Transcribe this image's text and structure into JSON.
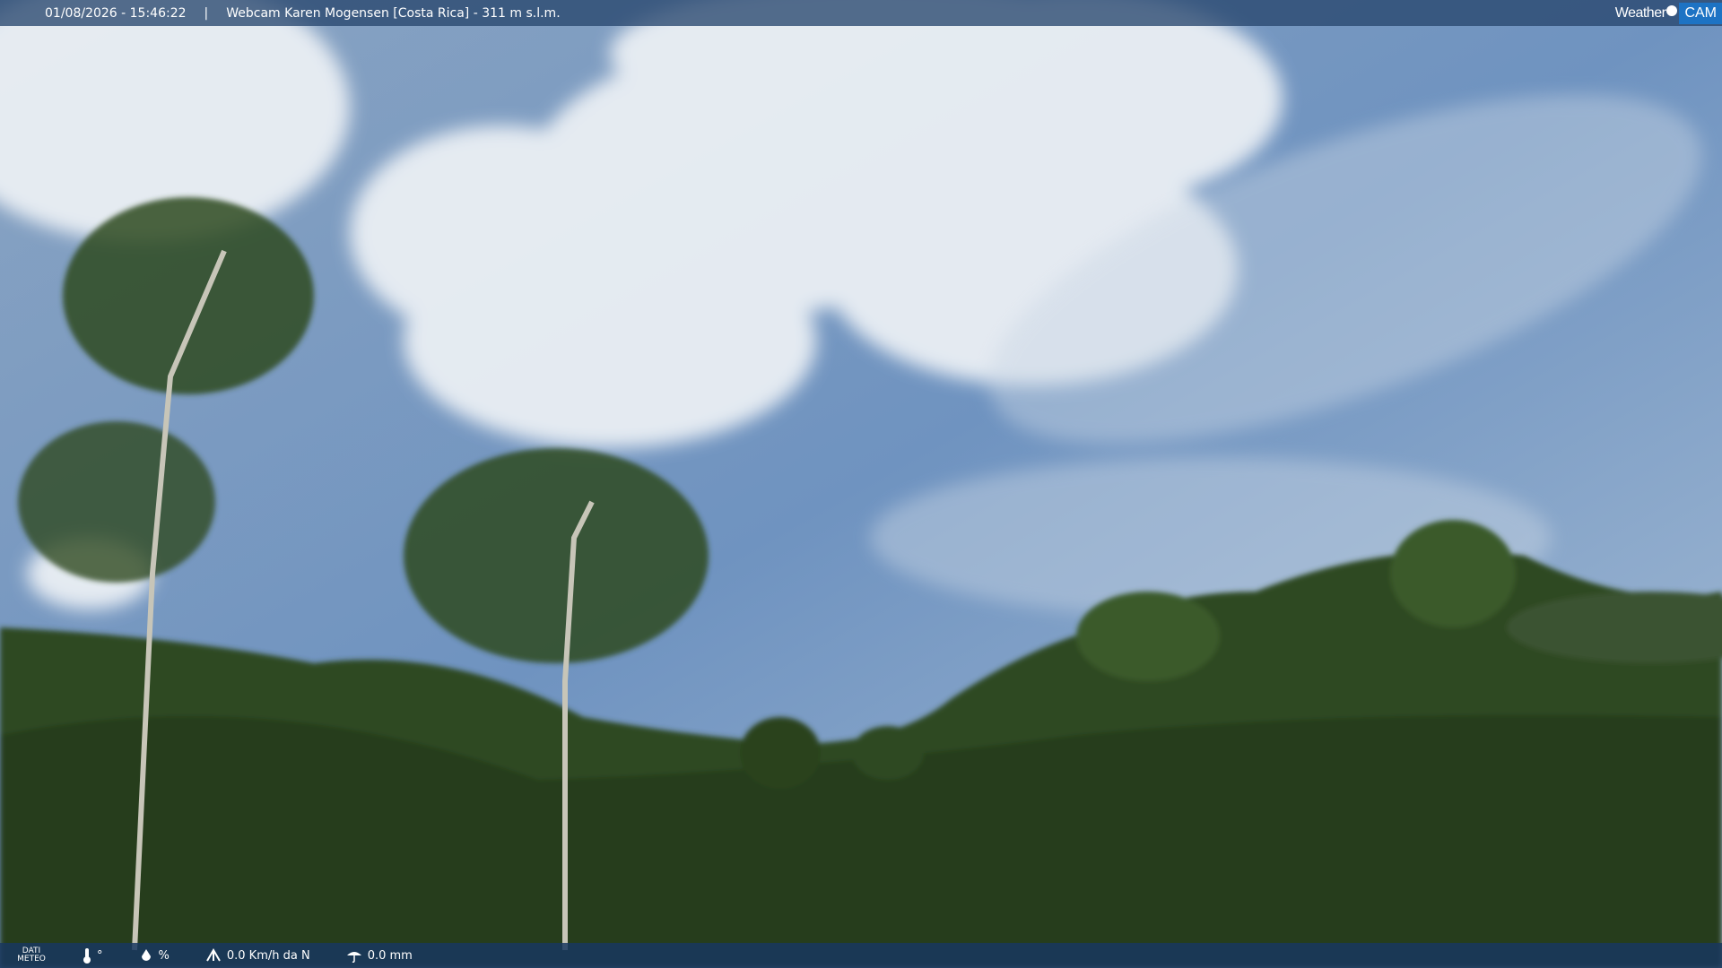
{
  "header": {
    "timestamp": "01/08/2026 - 15:46:22",
    "separator": "|",
    "title": "Webcam Karen Mogensen [Costa Rica] - 311 m s.l.m."
  },
  "logo": {
    "weather": "Weather",
    "cam": "CAM"
  },
  "footer": {
    "dati": "DATI",
    "meteo": "METEO",
    "temperature": "°",
    "humidity": "%",
    "wind": "0.0 Km/h da N",
    "rain": "0.0 mm",
    "icons": [
      "thermometer-icon",
      "humidity-icon",
      "wind-icon",
      "rain-icon"
    ]
  },
  "colors": {
    "sky": "#6f8fb3",
    "bar": "#28466e",
    "accent": "#1d73c4",
    "foliage": "#2f4a22"
  }
}
